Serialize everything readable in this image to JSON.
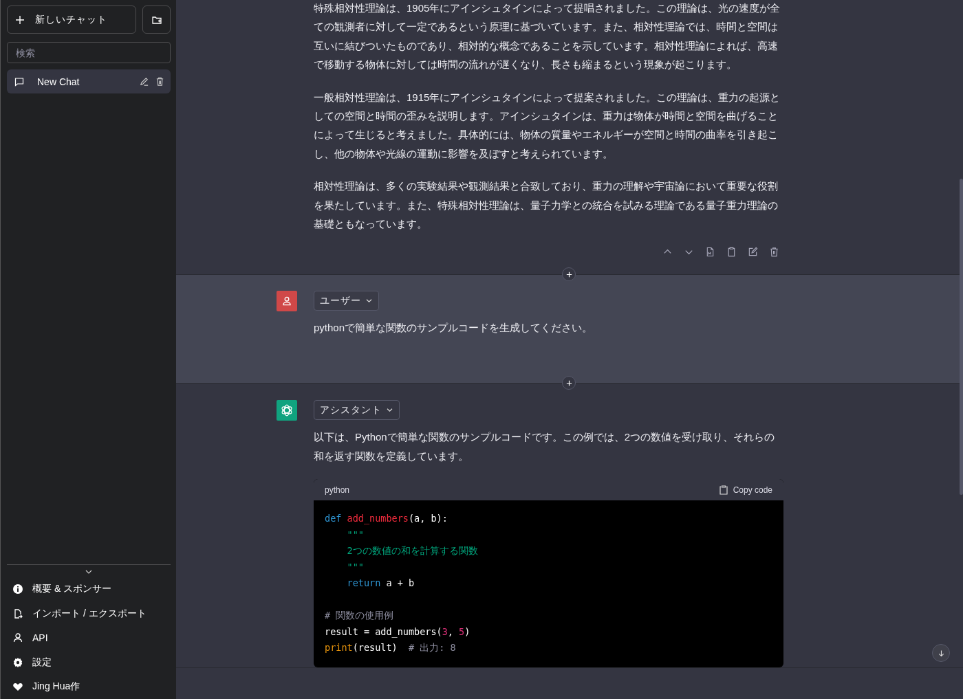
{
  "sidebar": {
    "new_chat_label": "新しいチャット",
    "search": {
      "placeholder": "検索"
    },
    "chats": [
      {
        "title": "New Chat",
        "selected": true
      }
    ],
    "menu": [
      {
        "label": "概要 & スポンサー",
        "kind": "info"
      },
      {
        "label": "インポート / エクスポート",
        "kind": "import"
      },
      {
        "label": "API",
        "kind": "user"
      },
      {
        "label": "設定",
        "kind": "settings"
      },
      {
        "label": "Jing Hua作",
        "kind": "heart"
      }
    ]
  },
  "messages": [
    {
      "kind": "assistant",
      "show_actions": true,
      "paragraphs": [
        "特殊相対性理論は、1905年にアインシュタインによって提唱されました。この理論は、光の速度が全ての観測者に対して一定であるという原理に基づいています。また、相対性理論では、時間と空間は互いに結びついたものであり、相対的な概念であることを示しています。相対性理論によれば、高速で移動する物体に対しては時間の流れが遅くなり、長さも縮まるという現象が起こります。",
        "一般相対性理論は、1915年にアインシュタインによって提案されました。この理論は、重力の起源としての空間と時間の歪みを説明します。アインシュタインは、重力は物体が時間と空間を曲げることによって生じると考えました。具体的には、物体の質量やエネルギーが空間と時間の曲率を引き起こし、他の物体や光線の運動に影響を及ぼすと考えられています。",
        "相対性理論は、多くの実験結果や観測結果と合致しており、重力の理解や宇宙論において重要な役割を果たしています。また、特殊相対性理論は、量子力学との統合を試みる理論である量子重力理論の基礎ともなっています。"
      ]
    },
    {
      "kind": "user",
      "role_label": "ユーザー",
      "show_actions": false,
      "paragraphs": [
        "pythonで簡単な関数のサンプルコードを生成してください。"
      ]
    },
    {
      "kind": "assistant",
      "role_label": "アシスタント",
      "show_actions": false,
      "paragraphs": [
        "以下は、Pythonで簡単な関数のサンプルコードです。この例では、2つの数値を受け取り、それらの和を返す関数を定義しています。"
      ],
      "code": {
        "language": "python",
        "copy_label": "Copy code",
        "lines": [
          {
            "kind": "code",
            "tokens": [
              {
                "kind": "keyword",
                "text": "def"
              },
              {
                "kind": "function",
                "text": " add_numbers"
              },
              {
                "kind": "plain",
                "text": "(a, b):"
              }
            ]
          },
          {
            "kind": "code",
            "tokens": [
              {
                "kind": "string",
                "text": "    \"\"\""
              }
            ]
          },
          {
            "kind": "code",
            "tokens": [
              {
                "kind": "string",
                "text": "    2つの数値の和を計算する関数"
              }
            ]
          },
          {
            "kind": "code",
            "tokens": [
              {
                "kind": "string",
                "text": "    \"\"\""
              }
            ]
          },
          {
            "kind": "code",
            "tokens": [
              {
                "kind": "keyword",
                "text": "    return"
              },
              {
                "kind": "plain",
                "text": " a + b"
              }
            ]
          },
          {
            "kind": "blank"
          },
          {
            "kind": "code",
            "tokens": [
              {
                "kind": "comment",
                "text": "# 関数の使用例"
              }
            ]
          },
          {
            "kind": "code",
            "tokens": [
              {
                "kind": "plain",
                "text": "result = add_numbers("
              },
              {
                "kind": "number",
                "text": "3"
              },
              {
                "kind": "plain",
                "text": ", "
              },
              {
                "kind": "number",
                "text": "5"
              },
              {
                "kind": "plain",
                "text": ")"
              }
            ]
          },
          {
            "kind": "code",
            "tokens": [
              {
                "kind": "builtin",
                "text": "print"
              },
              {
                "kind": "plain",
                "text": "(result)  "
              },
              {
                "kind": "comment",
                "text": "# 出力: 8"
              }
            ]
          }
        ]
      }
    }
  ]
}
